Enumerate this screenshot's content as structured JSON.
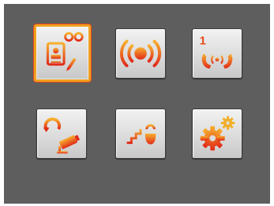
{
  "menu": {
    "tiles": [
      {
        "id": "t1",
        "icon": "address-book-voicemail-icon",
        "selected": true
      },
      {
        "id": "t2",
        "icon": "alarm-broadcast-icon",
        "selected": false
      },
      {
        "id": "t3",
        "icon": "call-one-icon",
        "badge": "1",
        "selected": false
      },
      {
        "id": "t4",
        "icon": "camera-cycle-icon",
        "selected": false
      },
      {
        "id": "t5",
        "icon": "stairs-light-icon",
        "selected": false
      },
      {
        "id": "t6",
        "icon": "settings-gears-icon",
        "selected": false
      }
    ]
  },
  "colors": {
    "background": "#5e5e5e",
    "tile": "#dcdcdc",
    "accent_start": "#f2a62a",
    "accent_end": "#e42b1a",
    "selection": "#f0a020"
  }
}
